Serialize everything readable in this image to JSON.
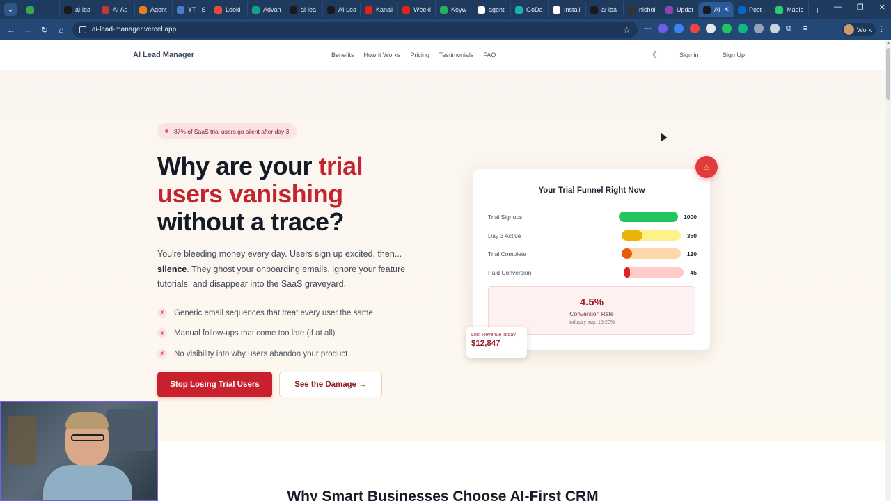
{
  "browser": {
    "tabs": [
      {
        "label": "",
        "color": "#34a853"
      },
      {
        "label": "ai-lea",
        "color": "#1a1a1a"
      },
      {
        "label": "AI Ag",
        "color": "#c0392b"
      },
      {
        "label": "Agent",
        "color": "#e67e22"
      },
      {
        "label": "YT - S",
        "color": "#4a7bd0"
      },
      {
        "label": "Looki",
        "color": "#e74c3c"
      },
      {
        "label": "Advan",
        "color": "#16a085"
      },
      {
        "label": "ai-lea",
        "color": "#1a1a1a"
      },
      {
        "label": "AI Lea",
        "color": "#1a1a1a"
      },
      {
        "label": "Kanali",
        "color": "#e62117"
      },
      {
        "label": "Weekl",
        "color": "#e62117"
      },
      {
        "label": "Keyw",
        "color": "#27ae60"
      },
      {
        "label": "agent",
        "color": "#ffffff"
      },
      {
        "label": "GoDa",
        "color": "#1bb3a9"
      },
      {
        "label": "Install",
        "color": "#ffffff"
      },
      {
        "label": "ai-lea",
        "color": "#1a1a1a"
      },
      {
        "label": "nichol",
        "color": "#333333"
      },
      {
        "label": "Updat",
        "color": "#8e44ad"
      },
      {
        "label": "AI",
        "color": "#1a1a1a"
      },
      {
        "label": "Post |",
        "color": "#0a66c2"
      },
      {
        "label": "Magic",
        "color": "#2ecc71"
      }
    ],
    "active_tab_index": 18,
    "url": "ai-lead-manager.vercel.app",
    "profile_label": "Work"
  },
  "site": {
    "brand": "AI Lead Manager",
    "nav": [
      "Benefits",
      "How it Works",
      "Pricing",
      "Testimonials",
      "FAQ"
    ],
    "sign_in": "Sign in",
    "sign_up": "Sign Up"
  },
  "hero": {
    "badge": "87% of SaaS trial users go silent after day 3",
    "headline_part1": "Why are your ",
    "headline_highlight": "trial users vanishing",
    "headline_part2": " without a trace?",
    "lead_part1": "You're bleeding money every day. Users sign up excited, then... ",
    "lead_bold": "silence",
    "lead_part2": ". They ghost your onboarding emails, ignore your feature tutorials, and disappear into the SaaS graveyard.",
    "pains": [
      "Generic email sequences that treat every user the same",
      "Manual follow-ups that come too late (if at all)",
      "No visibility into why users abandon your product"
    ],
    "pain_marker": "✗",
    "cta_primary": "Stop Losing Trial Users",
    "cta_secondary": "See the Damage →"
  },
  "funnel": {
    "title": "Your Trial Funnel Right Now",
    "rows": [
      {
        "label": "Trial Signups",
        "value": "1000",
        "fill": 1.0,
        "color": "#22c55e",
        "track": "#bbf7d0"
      },
      {
        "label": "Day 3 Active",
        "value": "350",
        "fill": 0.35,
        "color": "#eab308",
        "track": "#fef08a"
      },
      {
        "label": "Trial Complete",
        "value": "120",
        "fill": 0.18,
        "color": "#ea580c",
        "track": "#fed7aa"
      },
      {
        "label": "Paid Conversion",
        "value": "45",
        "fill": 0.08,
        "color": "#dc2626",
        "track": "#fecaca"
      }
    ],
    "conversion_rate": "4.5%",
    "conversion_label": "Conversion Rate",
    "industry_avg": "Industry avg: 15-20%",
    "lost_label": "Lost Revenue Today",
    "lost_value": "$12,847",
    "alert_icon": "warning-triangle-icon"
  },
  "next_section": {
    "title": "Why Smart Businesses Choose AI-First CRM"
  }
}
